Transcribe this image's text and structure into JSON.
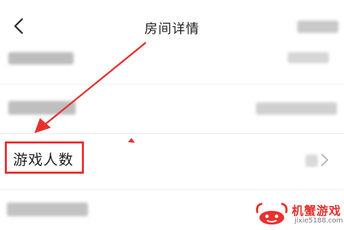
{
  "header": {
    "title": "房间详情",
    "back_icon": "chevron-left-icon"
  },
  "rows": [
    {
      "label": "游戏人数",
      "highlighted": true,
      "trailing_icon": "chevron-right-icon"
    }
  ],
  "annotation": {
    "arrow_color": "#e8312f",
    "highlight_color": "#e8312f"
  },
  "watermark": {
    "brand": "机蟹游戏",
    "url": "jixie5188.com"
  }
}
